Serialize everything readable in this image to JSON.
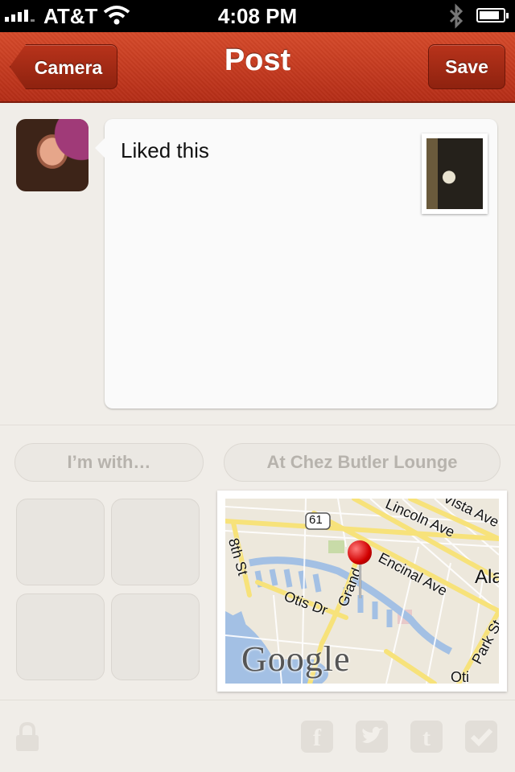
{
  "status_bar": {
    "carrier": "AT&T",
    "time": "4:08 PM"
  },
  "nav": {
    "title": "Post",
    "back_label": "Camera",
    "save_label": "Save"
  },
  "composer": {
    "text": "Liked this"
  },
  "tags": {
    "with_label": "I’m with…",
    "at_label": "At Chez Butler Lounge"
  },
  "map": {
    "labels": {
      "route": "61",
      "lincoln": "Lincoln Ave",
      "vista": "Vista Ave",
      "encinal": "Encinal Ave",
      "ala": "Ala",
      "grand": "Grand",
      "otis": "Otis Dr",
      "st8": "8th St",
      "park": "Park St",
      "oti": "Oti"
    },
    "logo": "Google"
  },
  "toolbar": {
    "icons": [
      "lock-icon",
      "facebook-icon",
      "twitter-icon",
      "tumblr-icon",
      "foursquare-icon"
    ]
  },
  "colors": {
    "nav_red": "#c33a1f",
    "background": "#f0ede8"
  }
}
